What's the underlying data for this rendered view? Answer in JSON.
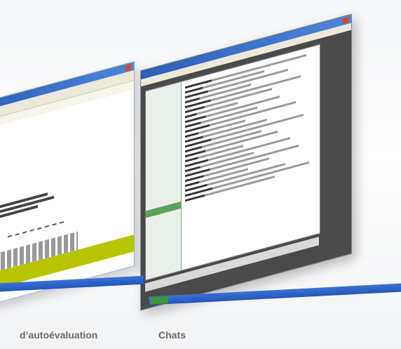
{
  "captions": {
    "left": "d’autoévaluation",
    "right": "Chats"
  },
  "colors": {
    "titlebar": "#2c5fb8",
    "taskbar": "#2455b8",
    "accent_yellow": "#b7c400",
    "chat_dark": "#4a4a4a",
    "caption": "#6b6b6b"
  }
}
